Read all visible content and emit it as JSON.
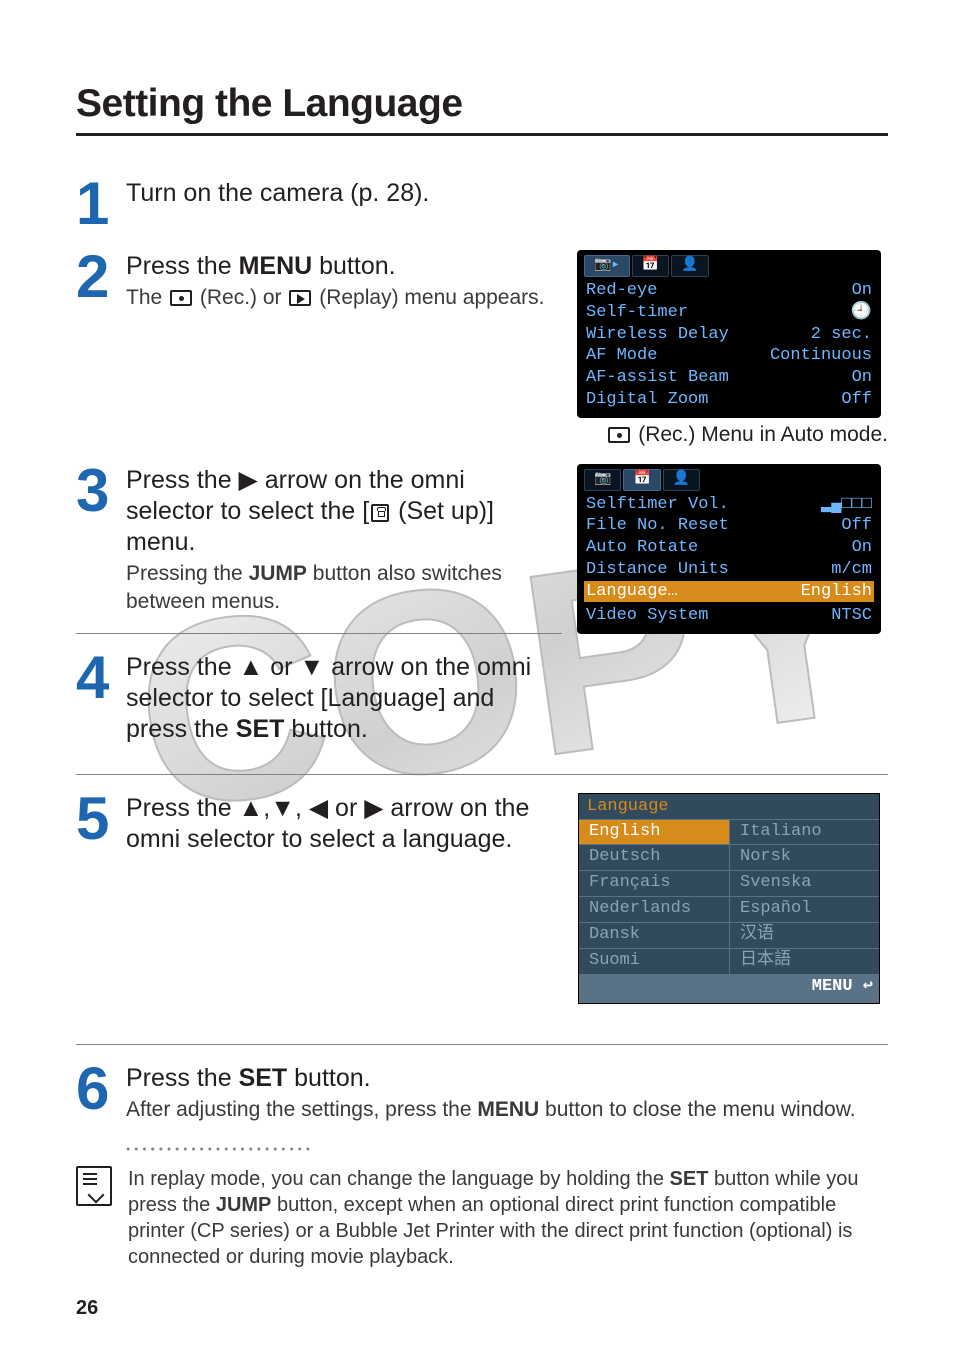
{
  "title": "Setting the Language",
  "steps": {
    "s1": {
      "num": "1",
      "head": "Turn on the camera (p. 28)."
    },
    "s2": {
      "num": "2",
      "head_a": "Press the ",
      "head_btn": "MENU",
      "head_b": " button.",
      "sub_a": "The ",
      "sub_b": " (Rec.) or ",
      "sub_c": " (Replay) menu appears."
    },
    "s3": {
      "num": "3",
      "head": "Press the ▶ arrow on the omni selector to select the [",
      "head_tail": " (Set up)] menu.",
      "sub_a": "Pressing the ",
      "sub_btn": "JUMP",
      "sub_b": " button also switches between menus."
    },
    "s4": {
      "num": "4",
      "head_a": "Press the ▲ or ▼ arrow on the omni selector to select [Language] and press the ",
      "head_btn": "SET",
      "head_b": " button."
    },
    "s5": {
      "num": "5",
      "head": "Press the ▲,▼, ◀ or ▶ arrow on the omni selector to select a language."
    },
    "s6": {
      "num": "6",
      "head_a": "Press the ",
      "head_btn": "SET",
      "head_b": " button.",
      "sub_a": "After adjusting the settings, press the ",
      "sub_btn": "MENU",
      "sub_b": " button to close the menu window."
    }
  },
  "rec_lcd": {
    "caption": " (Rec.) Menu in Auto mode.",
    "rows": [
      {
        "k": "Red-eye",
        "v": "On"
      },
      {
        "k": "Self-timer",
        "v": "🕘"
      },
      {
        "k": "Wireless Delay",
        "v": "2 sec."
      },
      {
        "k": "AF Mode",
        "v": "Continuous"
      },
      {
        "k": "AF-assist Beam",
        "v": "On"
      },
      {
        "k": "Digital Zoom",
        "v": "Off"
      }
    ],
    "tabs": [
      "📷▸",
      "📅",
      "👤"
    ]
  },
  "setup_lcd": {
    "rows": [
      {
        "k": "Selftimer Vol.",
        "v": "▂▄□□□"
      },
      {
        "k": "File No. Reset",
        "v": "Off"
      },
      {
        "k": "Auto Rotate",
        "v": "On"
      },
      {
        "k": "Distance Units",
        "v": "m/cm"
      }
    ],
    "sel": {
      "k": "Language…",
      "v": "English"
    },
    "last": {
      "k": "Video System",
      "v": "NTSC"
    },
    "tabs": [
      "📷",
      "📅",
      "👤"
    ]
  },
  "lang_lcd": {
    "header": "Language",
    "left": [
      "English",
      "Deutsch",
      "Français",
      "Nederlands",
      "Dansk",
      "Suomi"
    ],
    "right": [
      "Italiano",
      "Norsk",
      "Svenska",
      "Español",
      "汉语",
      "日本語"
    ],
    "footer": "MENU ↩"
  },
  "tip": {
    "a": "In replay mode, you can change the language by holding the ",
    "btn1": "SET",
    "b": " button while you press the ",
    "btn2": "JUMP",
    "c": " button, except when an optional direct print function compatible printer (CP series) or a Bubble Jet Printer with the direct print function (optional) is connected or during movie playback."
  },
  "page_number": "26"
}
